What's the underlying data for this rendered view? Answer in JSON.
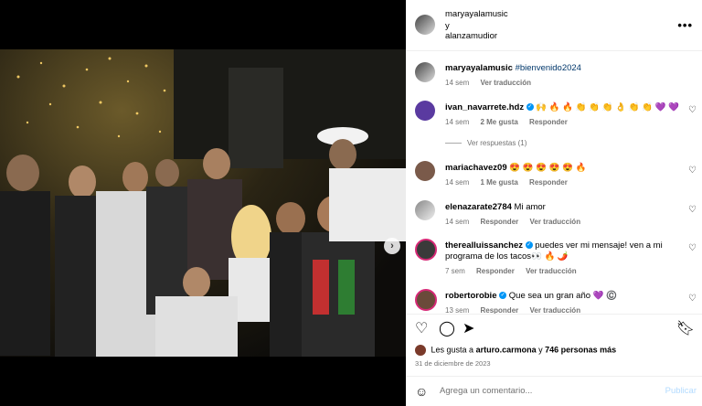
{
  "post": {
    "author": "maryayalamusic",
    "joiner": "y",
    "coauthor": "alanzamudior",
    "more_icon": "more-horizontal-icon"
  },
  "caption": {
    "user": "maryayalamusic",
    "text": "#bienvenido2024",
    "time": "14 sem",
    "translate": "Ver traducción"
  },
  "comments": [
    {
      "user": "ivan_navarrete.hdz",
      "verified": true,
      "text": "🙌 🔥 🔥 👏 👏 👏 👌 👏 👏 💜 💜",
      "time": "14 sem",
      "likes": "2 Me gusta",
      "reply": "Responder",
      "view_replies": "Ver respuestas (1)"
    },
    {
      "user": "mariachavez09",
      "verified": false,
      "text": "😍 😍 😍 😍 😍 🔥",
      "time": "14 sem",
      "likes": "1 Me gusta",
      "reply": "Responder"
    },
    {
      "user": "elenazarate2784",
      "verified": false,
      "text": "Mi amor",
      "time": "14 sem",
      "reply": "Responder",
      "translate": "Ver traducción"
    },
    {
      "user": "therealluissanchez",
      "verified": true,
      "text": "puedes ver mi mensaje! ven a mi programa de los tacos👀 🔥 🌶️",
      "time": "7 sem",
      "reply": "Responder",
      "translate": "Ver traducción"
    },
    {
      "user": "robertorobie",
      "verified": true,
      "text": "Que sea un gran año 💜 ©️",
      "time": "13 sem",
      "reply": "Responder",
      "translate": "Ver traducción"
    }
  ],
  "actions": {
    "like_icon": "heart-icon",
    "comment_icon": "comment-icon",
    "share_icon": "send-icon",
    "save_icon": "bookmark-icon"
  },
  "likes": {
    "prefix": "Les gusta a",
    "user": "arturo.carmona",
    "joiner": "y",
    "count": "746 personas más"
  },
  "date": "31 de diciembre de 2023",
  "add_comment": {
    "placeholder": "Agrega un comentario...",
    "publish": "Publicar"
  },
  "colors": {
    "accent": "#0095f6",
    "publish_disabled": "#b3dbff",
    "meta": "#737373"
  }
}
